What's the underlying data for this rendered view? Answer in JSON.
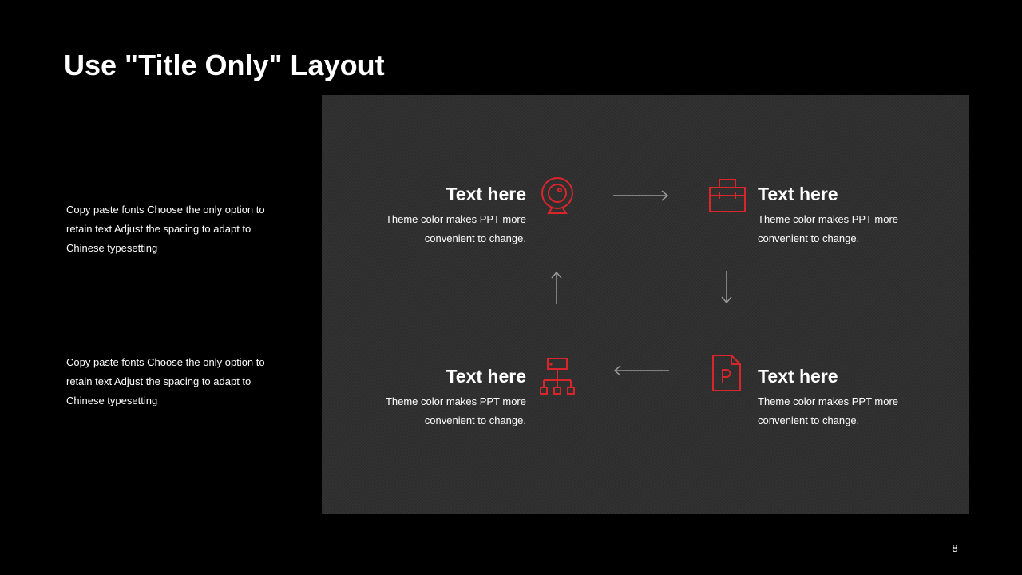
{
  "slide": {
    "title": "Use \"Title Only\" Layout",
    "page_number": "8"
  },
  "side_texts": [
    "Copy paste fonts Choose the only option to retain text Adjust the spacing to adapt to Chinese  typesetting",
    "Copy paste fonts Choose the only option to retain text Adjust the spacing to adapt to Chinese  typesetting"
  ],
  "blocks": [
    {
      "title": "Text here",
      "desc": "Theme  color makes PPT more convenient  to change.",
      "icon": "webcam-icon"
    },
    {
      "title": "Text here",
      "desc": "Theme  color makes PPT more convenient  to change.",
      "icon": "briefcase-icon"
    },
    {
      "title": "Text here",
      "desc": "Theme  color makes PPT more convenient  to change.",
      "icon": "org-chart-icon"
    },
    {
      "title": "Text here",
      "desc": "Theme  color makes PPT more convenient  to change.",
      "icon": "powerpoint-file-icon"
    }
  ],
  "colors": {
    "background": "#000000",
    "panel": "#303030",
    "accent": "#d9262b",
    "arrow": "#9a9a9a",
    "text": "#ffffff"
  }
}
